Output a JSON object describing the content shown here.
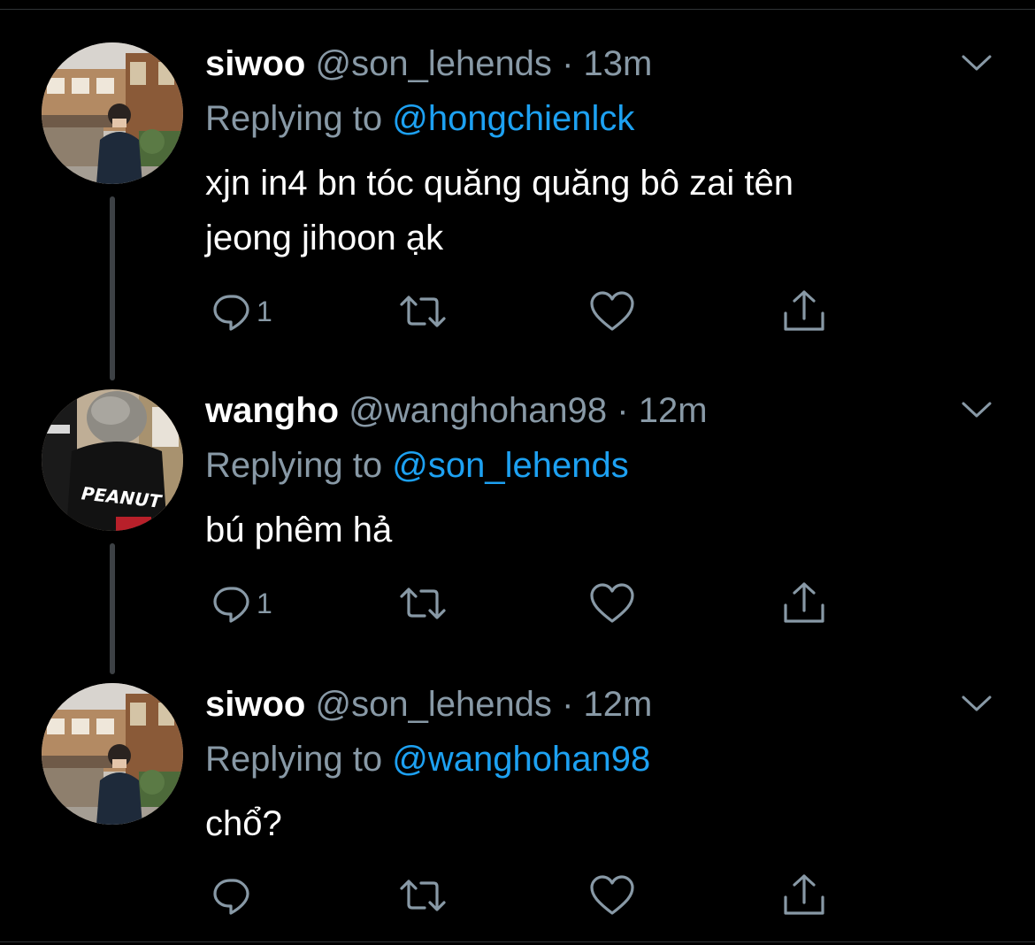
{
  "colors": {
    "background": "#000000",
    "name": "#ffffff",
    "secondary": "#8899a6",
    "mention": "#1da1f2",
    "thread_line": "#3d4145"
  },
  "tweets": [
    {
      "name": "siwoo",
      "handle": "@son_lehends",
      "separator": "·",
      "time": "13m",
      "replying_prefix": "Replying to ",
      "replying_to": "@hongchienlck",
      "text_line1": "xjn in4 bn tóc quăng quăng bô zai tên",
      "text_line2": "jeong jihoon ạk",
      "reply_count": "1",
      "avatar_icon": "avatar-street-photo",
      "icons": [
        "reply-icon",
        "retweet-icon",
        "like-icon",
        "share-icon",
        "caret-down-icon"
      ]
    },
    {
      "name": "wangho",
      "handle": "@wanghohan98",
      "separator": "·",
      "time": "12m",
      "replying_prefix": "Replying to ",
      "replying_to": "@son_lehends",
      "text_line1": "bú phêm hả",
      "reply_count": "1",
      "avatar_icon": "avatar-peanut-jacket",
      "avatar_text": "PEANUT",
      "icons": [
        "reply-icon",
        "retweet-icon",
        "like-icon",
        "share-icon",
        "caret-down-icon"
      ]
    },
    {
      "name": "siwoo",
      "handle": "@son_lehends",
      "separator": "·",
      "time": "12m",
      "replying_prefix": "Replying to ",
      "replying_to": "@wanghohan98",
      "text_line1": "chổ?",
      "reply_count": "",
      "avatar_icon": "avatar-street-photo",
      "icons": [
        "reply-icon",
        "retweet-icon",
        "like-icon",
        "share-icon",
        "caret-down-icon"
      ]
    }
  ]
}
